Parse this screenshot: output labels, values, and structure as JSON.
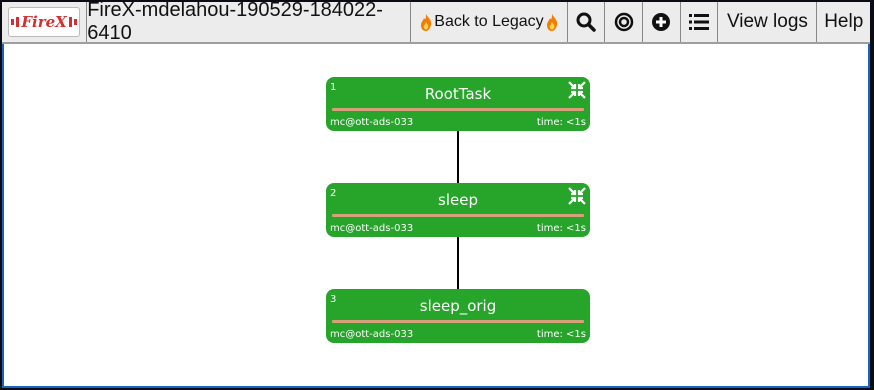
{
  "app": {
    "logo_text": "FireX",
    "title": "FireX-mdelahou-190529-184022-6410",
    "legacy_label": "Back to Legacy",
    "view_logs_label": "View logs",
    "help_label": "Help"
  },
  "colors": {
    "node_green": "#26a52a",
    "separator": "#d8a07a",
    "frame_blue": "#1565c0"
  },
  "toolbar_icons": [
    "search-icon",
    "target-icon",
    "plus-circle-icon",
    "list-icon"
  ],
  "nodes": [
    {
      "num": "1",
      "name": "RootTask",
      "host": "mc@ott-ads-033",
      "time": "time: <1s",
      "collapsible": true
    },
    {
      "num": "2",
      "name": "sleep",
      "host": "mc@ott-ads-033",
      "time": "time: <1s",
      "collapsible": true
    },
    {
      "num": "3",
      "name": "sleep_orig",
      "host": "mc@ott-ads-033",
      "time": "time: <1s",
      "collapsible": false
    }
  ]
}
